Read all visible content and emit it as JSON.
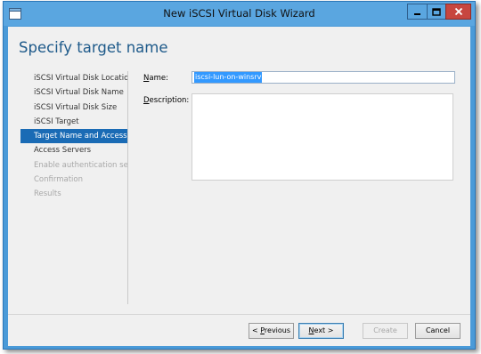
{
  "window": {
    "title": "New iSCSI Virtual Disk Wizard"
  },
  "page": {
    "heading": "Specify target name"
  },
  "nav": {
    "items": [
      {
        "label": "iSCSI Virtual Disk Location",
        "state": "normal"
      },
      {
        "label": "iSCSI Virtual Disk Name",
        "state": "normal"
      },
      {
        "label": "iSCSI Virtual Disk Size",
        "state": "normal"
      },
      {
        "label": "iSCSI Target",
        "state": "normal"
      },
      {
        "label": "Target Name and Access",
        "state": "active"
      },
      {
        "label": "Access Servers",
        "state": "normal"
      },
      {
        "label": "Enable authentication ser...",
        "state": "disabled"
      },
      {
        "label": "Confirmation",
        "state": "disabled"
      },
      {
        "label": "Results",
        "state": "disabled"
      }
    ]
  },
  "form": {
    "name_label_prefix": "",
    "name_label_accel": "N",
    "name_label_rest": "ame:",
    "name_value": "iscsi-lun-on-winsrv",
    "description_label_accel": "D",
    "description_label_rest": "escription:",
    "description_value": ""
  },
  "buttons": {
    "previous_prefix": "< ",
    "previous_accel": "P",
    "previous_rest": "revious",
    "next_accel": "N",
    "next_rest": "ext >",
    "create": "Create",
    "cancel": "Cancel"
  },
  "colors": {
    "accent": "#1a6bb5",
    "titlebar": "#5aa6e0",
    "close": "#c7463f",
    "heading": "#1e5a8a"
  }
}
